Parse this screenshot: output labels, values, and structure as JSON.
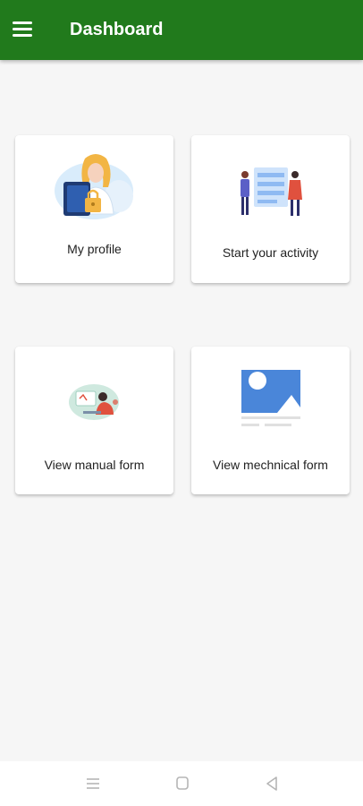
{
  "app_bar": {
    "title": "Dashboard",
    "background": "#217a1c",
    "menu_icon": "hamburger-menu-icon"
  },
  "cards": [
    {
      "label": "My profile",
      "illustration": "profile-illustration-icon"
    },
    {
      "label": "Start your activity",
      "illustration": "activity-illustration-icon"
    },
    {
      "label": "View manual form",
      "illustration": "manual-form-illustration-icon"
    },
    {
      "label": "View mechnical form",
      "illustration": "mechanical-form-illustration-icon"
    }
  ],
  "nav_bar": {
    "recents_icon": "recents-icon",
    "home_icon": "home-square-icon",
    "back_icon": "back-triangle-icon"
  }
}
